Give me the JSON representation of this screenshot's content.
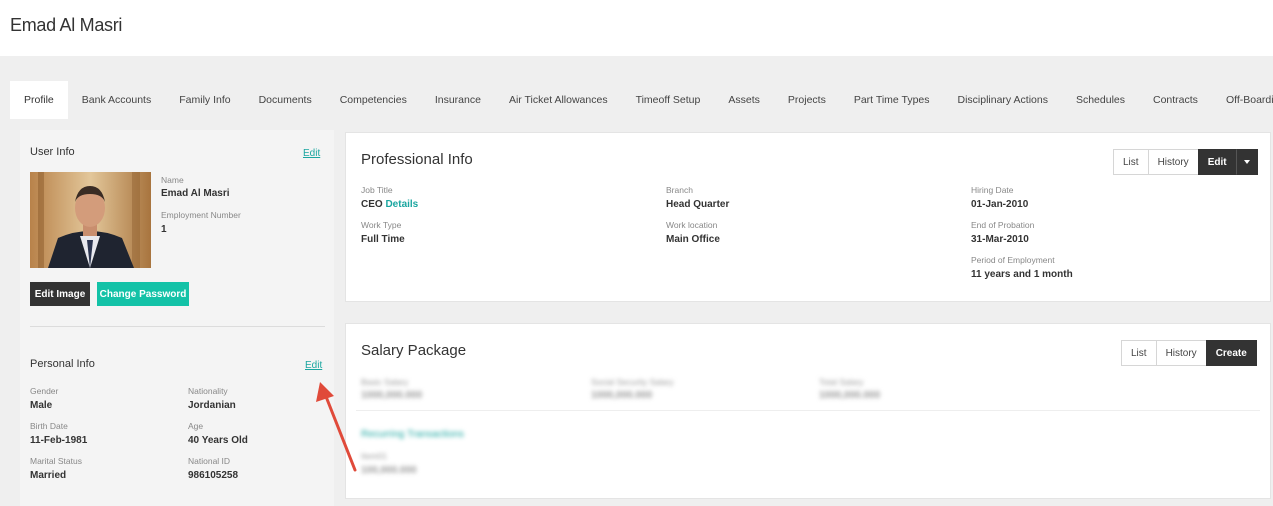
{
  "header": {
    "title": "Emad Al Masri"
  },
  "tabs": [
    {
      "label": "Profile"
    },
    {
      "label": "Bank Accounts"
    },
    {
      "label": "Family Info"
    },
    {
      "label": "Documents"
    },
    {
      "label": "Competencies"
    },
    {
      "label": "Insurance"
    },
    {
      "label": "Air Ticket Allowances"
    },
    {
      "label": "Timeoff Setup"
    },
    {
      "label": "Assets"
    },
    {
      "label": "Projects"
    },
    {
      "label": "Part Time Types"
    },
    {
      "label": "Disciplinary Actions"
    },
    {
      "label": "Schedules"
    },
    {
      "label": "Contracts"
    },
    {
      "label": "Off-Boarding"
    }
  ],
  "user_info": {
    "title": "User Info",
    "edit_label": "Edit",
    "name_label": "Name",
    "name_value": "Emad Al Masri",
    "emp_label": "Employment Number",
    "emp_value": "1",
    "edit_image_label": "Edit Image",
    "change_password_label": "Change Password"
  },
  "personal_info": {
    "title": "Personal Info",
    "edit_label": "Edit",
    "gender_label": "Gender",
    "gender_value": "Male",
    "nationality_label": "Nationality",
    "nationality_value": "Jordanian",
    "birth_label": "Birth Date",
    "birth_value": "11-Feb-1981",
    "age_label": "Age",
    "age_value": "40 Years Old",
    "marital_label": "Marital Status",
    "marital_value": "Married",
    "national_id_label": "National ID",
    "national_id_value": "986105258"
  },
  "professional_info": {
    "title": "Professional Info",
    "list_label": "List",
    "history_label": "History",
    "edit_label": "Edit",
    "job_title_label": "Job Title",
    "job_title_value": "CEO",
    "details_link": "Details",
    "branch_label": "Branch",
    "branch_value": "Head Quarter",
    "hiring_label": "Hiring Date",
    "hiring_value": "01-Jan-2010",
    "work_type_label": "Work Type",
    "work_type_value": "Full Time",
    "work_location_label": "Work location",
    "work_location_value": "Main Office",
    "probation_label": "End of Probation",
    "probation_value": "31-Mar-2010",
    "period_label": "Period of Employment",
    "period_value": "11 years and 1 month"
  },
  "salary_package": {
    "title": "Salary Package",
    "list_label": "List",
    "history_label": "History",
    "create_label": "Create",
    "basic_label": "Basic Salary",
    "basic_value": "1000,000.000",
    "social_label": "Social Security Salary",
    "social_value": "1000,000.000",
    "total_label": "Total Salary",
    "total_value": "1000,000.000",
    "recurring_label": "Recurring Transactions",
    "item_label": "Item01",
    "item_value": "100,000.000"
  },
  "colors": {
    "accent": "#1aa6a0",
    "teal_button": "#13c2a7",
    "dark_button": "#333333",
    "arrow": "#e04a3a"
  }
}
